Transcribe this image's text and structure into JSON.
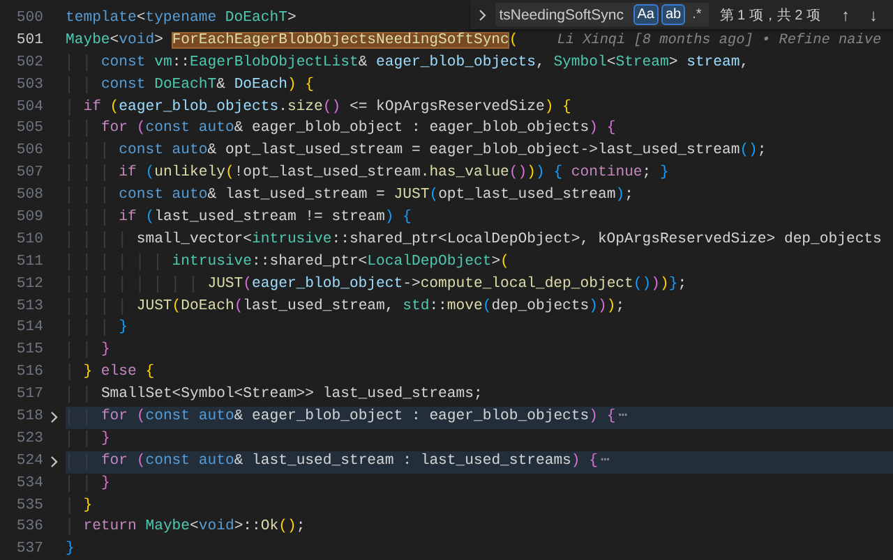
{
  "find_widget": {
    "query": "tsNeedingSoftSync",
    "options": [
      {
        "label": "Aa",
        "selected": true
      },
      {
        "label": "ab",
        "selected": true
      },
      {
        "label": ".*",
        "selected": false
      }
    ],
    "result": "第 1 项，共 2 项",
    "buttons": [
      "↑",
      "↓"
    ]
  },
  "lines": [
    {
      "number": "500",
      "current": false,
      "folded": false,
      "tokens": [
        {
          "text": "template",
          "kind": "kw"
        },
        {
          "text": "<",
          "kind": "txt"
        },
        {
          "text": "typename",
          "kind": "kw"
        },
        {
          "text": " DoEachT",
          "kind": "type"
        },
        {
          "text": ">",
          "kind": "txt"
        }
      ]
    },
    {
      "number": "501",
      "current": true,
      "folded": false,
      "blame": "Li Xinqi [8 months ago] • Refine naive",
      "tokens": [
        {
          "text": "Maybe",
          "kind": "type"
        },
        {
          "text": "<",
          "kind": "txt"
        },
        {
          "text": "void",
          "kind": "kw"
        },
        {
          "text": "> ",
          "kind": "txt"
        },
        {
          "text": "ForEachEagerBlobObjectsNeedingSoftSync",
          "kind": "match"
        },
        {
          "text": "(",
          "kind": "b1"
        }
      ]
    },
    {
      "number": "502",
      "current": false,
      "folded": false,
      "tokens": [
        {
          "text": "    const",
          "kind": "kw"
        },
        {
          "text": " vm",
          "kind": "type"
        },
        {
          "text": "::",
          "kind": "txt"
        },
        {
          "text": "EagerBlobObjectList",
          "kind": "type"
        },
        {
          "text": "& ",
          "kind": "txt"
        },
        {
          "text": "eager_blob_objects",
          "kind": "var"
        },
        {
          "text": ", ",
          "kind": "txt"
        },
        {
          "text": "Symbol",
          "kind": "type"
        },
        {
          "text": "<",
          "kind": "txt"
        },
        {
          "text": "Stream",
          "kind": "type"
        },
        {
          "text": "> ",
          "kind": "txt"
        },
        {
          "text": "stream",
          "kind": "var"
        },
        {
          "text": ",",
          "kind": "txt"
        }
      ]
    },
    {
      "number": "503",
      "current": false,
      "folded": false,
      "tokens": [
        {
          "text": "    const",
          "kind": "kw"
        },
        {
          "text": " DoEachT",
          "kind": "type"
        },
        {
          "text": "& ",
          "kind": "txt"
        },
        {
          "text": "DoEach",
          "kind": "var"
        },
        {
          "text": ")",
          "kind": "b1"
        },
        {
          "text": " {",
          "kind": "b1"
        }
      ]
    },
    {
      "number": "504",
      "current": false,
      "folded": false,
      "tokens": [
        {
          "text": "  if",
          "kind": "ctl"
        },
        {
          "text": " (",
          "kind": "b1"
        },
        {
          "text": "eager_blob_objects",
          "kind": "var"
        },
        {
          "text": ".",
          "kind": "txt"
        },
        {
          "text": "size",
          "kind": "fn"
        },
        {
          "text": "()",
          "kind": "b2"
        },
        {
          "text": " <= kOpArgsReservedSize",
          "kind": "txt"
        },
        {
          "text": ")",
          "kind": "b1"
        },
        {
          "text": " {",
          "kind": "b1"
        }
      ]
    },
    {
      "number": "505",
      "current": false,
      "folded": false,
      "tokens": [
        {
          "text": "    for",
          "kind": "ctl"
        },
        {
          "text": " (",
          "kind": "b2"
        },
        {
          "text": "const",
          "kind": "kw"
        },
        {
          "text": " auto",
          "kind": "kw"
        },
        {
          "text": "& eager_blob_object : eager_blob_objects",
          "kind": "txt"
        },
        {
          "text": ")",
          "kind": "b2"
        },
        {
          "text": " {",
          "kind": "b2"
        }
      ]
    },
    {
      "number": "506",
      "current": false,
      "folded": false,
      "tokens": [
        {
          "text": "      const",
          "kind": "kw"
        },
        {
          "text": " auto",
          "kind": "kw"
        },
        {
          "text": "& opt_last_used_stream = eager_blob_object->last_used_stream",
          "kind": "txt"
        },
        {
          "text": "()",
          "kind": "b3"
        },
        {
          "text": ";",
          "kind": "txt"
        }
      ]
    },
    {
      "number": "507",
      "current": false,
      "folded": false,
      "tokens": [
        {
          "text": "      if",
          "kind": "ctl"
        },
        {
          "text": " (",
          "kind": "b3"
        },
        {
          "text": "unlikely",
          "kind": "fn"
        },
        {
          "text": "(",
          "kind": "b1"
        },
        {
          "text": "!opt_last_used_stream.",
          "kind": "txt"
        },
        {
          "text": "has_value",
          "kind": "fn"
        },
        {
          "text": "()",
          "kind": "b2"
        },
        {
          "text": ")",
          "kind": "b1"
        },
        {
          "text": ")",
          "kind": "b3"
        },
        {
          "text": " {",
          "kind": "b3"
        },
        {
          "text": " continue",
          "kind": "ctl"
        },
        {
          "text": ";",
          "kind": "txt"
        },
        {
          "text": " }",
          "kind": "b3"
        }
      ]
    },
    {
      "number": "508",
      "current": false,
      "folded": false,
      "tokens": [
        {
          "text": "      const",
          "kind": "kw"
        },
        {
          "text": " auto",
          "kind": "kw"
        },
        {
          "text": "& last_used_stream = ",
          "kind": "txt"
        },
        {
          "text": "JUST",
          "kind": "fn"
        },
        {
          "text": "(",
          "kind": "b3"
        },
        {
          "text": "opt_last_used_stream",
          "kind": "txt"
        },
        {
          "text": ")",
          "kind": "b3"
        },
        {
          "text": ";",
          "kind": "txt"
        }
      ]
    },
    {
      "number": "509",
      "current": false,
      "folded": false,
      "tokens": [
        {
          "text": "      if",
          "kind": "ctl"
        },
        {
          "text": " (",
          "kind": "b3"
        },
        {
          "text": "last_used_stream != stream",
          "kind": "txt"
        },
        {
          "text": ")",
          "kind": "b3"
        },
        {
          "text": " {",
          "kind": "b3"
        }
      ]
    },
    {
      "number": "510",
      "current": false,
      "folded": false,
      "tokens": [
        {
          "text": "        small_vector<",
          "kind": "txt"
        },
        {
          "text": "intrusive",
          "kind": "type"
        },
        {
          "text": "::shared_ptr<LocalDepObject>, kOpArgsReservedSize> dep_objects",
          "kind": "txt"
        }
      ]
    },
    {
      "number": "511",
      "current": false,
      "folded": false,
      "tokens": [
        {
          "text": "            intrusive",
          "kind": "type"
        },
        {
          "text": "::shared_ptr<",
          "kind": "txt"
        },
        {
          "text": "LocalDepObject",
          "kind": "type"
        },
        {
          "text": ">",
          "kind": "txt"
        },
        {
          "text": "(",
          "kind": "b1"
        }
      ]
    },
    {
      "number": "512",
      "current": false,
      "folded": false,
      "tokens": [
        {
          "text": "                JUST",
          "kind": "fn"
        },
        {
          "text": "(",
          "kind": "b2"
        },
        {
          "text": "eager_blob_object",
          "kind": "var"
        },
        {
          "text": "->",
          "kind": "txt"
        },
        {
          "text": "compute_local_dep_object",
          "kind": "fn"
        },
        {
          "text": "()",
          "kind": "b3"
        },
        {
          "text": ")",
          "kind": "b2"
        },
        {
          "text": ")",
          "kind": "b1"
        },
        {
          "text": "}",
          "kind": "b3"
        },
        {
          "text": ";",
          "kind": "txt"
        }
      ]
    },
    {
      "number": "513",
      "current": false,
      "folded": false,
      "tokens": [
        {
          "text": "        JUST",
          "kind": "fn"
        },
        {
          "text": "(",
          "kind": "b1"
        },
        {
          "text": "DoEach",
          "kind": "fn"
        },
        {
          "text": "(",
          "kind": "b2"
        },
        {
          "text": "last_used_stream, ",
          "kind": "txt"
        },
        {
          "text": "std",
          "kind": "type"
        },
        {
          "text": "::",
          "kind": "txt"
        },
        {
          "text": "move",
          "kind": "fn"
        },
        {
          "text": "(",
          "kind": "b3"
        },
        {
          "text": "dep_objects",
          "kind": "txt"
        },
        {
          "text": ")",
          "kind": "b3"
        },
        {
          "text": ")",
          "kind": "b2"
        },
        {
          "text": ")",
          "kind": "b1"
        },
        {
          "text": ";",
          "kind": "txt"
        }
      ]
    },
    {
      "number": "514",
      "current": false,
      "folded": false,
      "tokens": [
        {
          "text": "      }",
          "kind": "b3"
        }
      ]
    },
    {
      "number": "515",
      "current": false,
      "folded": false,
      "tokens": [
        {
          "text": "    }",
          "kind": "b2"
        }
      ]
    },
    {
      "number": "516",
      "current": false,
      "folded": false,
      "tokens": [
        {
          "text": "  }",
          "kind": "b1"
        },
        {
          "text": " else",
          "kind": "ctl"
        },
        {
          "text": " {",
          "kind": "b1"
        }
      ]
    },
    {
      "number": "517",
      "current": false,
      "folded": false,
      "tokens": [
        {
          "text": "    SmallSet<Symbol<Stream>> last_used_streams;",
          "kind": "txt"
        }
      ]
    },
    {
      "number": "518",
      "current": false,
      "folded": true,
      "fold_marker": "⋯",
      "tokens": [
        {
          "text": "    for",
          "kind": "ctl"
        },
        {
          "text": " (",
          "kind": "b2"
        },
        {
          "text": "const",
          "kind": "kw"
        },
        {
          "text": " auto",
          "kind": "kw"
        },
        {
          "text": "& eager_blob_object : eager_blob_objects",
          "kind": "txt"
        },
        {
          "text": ")",
          "kind": "b2"
        },
        {
          "text": " {",
          "kind": "b2"
        }
      ]
    },
    {
      "number": "523",
      "current": false,
      "folded": false,
      "tokens": [
        {
          "text": "    }",
          "kind": "b2"
        }
      ]
    },
    {
      "number": "524",
      "current": false,
      "folded": true,
      "fold_marker": "⋯",
      "tokens": [
        {
          "text": "    for",
          "kind": "ctl"
        },
        {
          "text": " (",
          "kind": "b2"
        },
        {
          "text": "const",
          "kind": "kw"
        },
        {
          "text": " auto",
          "kind": "kw"
        },
        {
          "text": "& last_used_stream : last_used_streams",
          "kind": "txt"
        },
        {
          "text": ")",
          "kind": "b2"
        },
        {
          "text": " {",
          "kind": "b2"
        }
      ]
    },
    {
      "number": "534",
      "current": false,
      "folded": false,
      "tokens": [
        {
          "text": "    }",
          "kind": "b2"
        }
      ]
    },
    {
      "number": "535",
      "current": false,
      "folded": false,
      "tokens": [
        {
          "text": "  }",
          "kind": "b1"
        }
      ]
    },
    {
      "number": "536",
      "current": false,
      "folded": false,
      "tokens": [
        {
          "text": "  return",
          "kind": "ctl"
        },
        {
          "text": " Maybe",
          "kind": "type"
        },
        {
          "text": "<",
          "kind": "txt"
        },
        {
          "text": "void",
          "kind": "kw"
        },
        {
          "text": ">::",
          "kind": "txt"
        },
        {
          "text": "Ok",
          "kind": "fn"
        },
        {
          "text": "()",
          "kind": "b1"
        },
        {
          "text": ";",
          "kind": "txt"
        }
      ]
    },
    {
      "number": "537",
      "current": false,
      "folded": false,
      "tokens": [
        {
          "text": "}",
          "kind": "b3"
        }
      ]
    }
  ]
}
